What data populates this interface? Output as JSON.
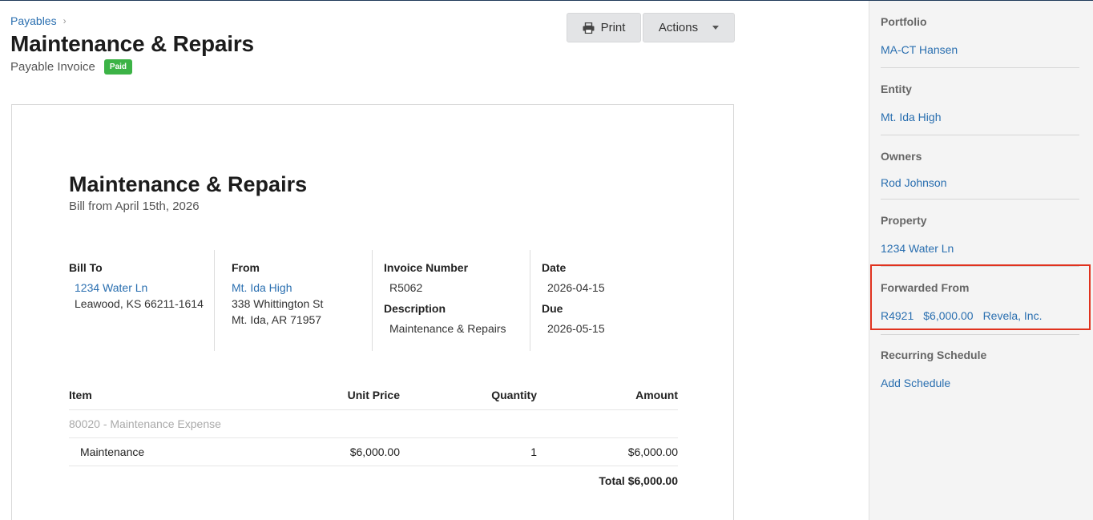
{
  "breadcrumb": {
    "parent": "Payables",
    "chevron": "›"
  },
  "header": {
    "title": "Maintenance & Repairs",
    "subtitle": "Payable Invoice",
    "status_badge": "Paid",
    "status_color": "#3cb346"
  },
  "toolbar": {
    "print_label": "Print",
    "actions_label": "Actions"
  },
  "invoice": {
    "title": "Maintenance & Repairs",
    "subtitle": "Bill from April 15th, 2026",
    "bill_to": {
      "label": "Bill To",
      "name": "1234 Water Ln",
      "address1": "Leawood, KS 66211-1614"
    },
    "from": {
      "label": "From",
      "name": "Mt. Ida High",
      "address1": "338 Whittington St",
      "address2": "Mt. Ida, AR 71957"
    },
    "invoice_number": {
      "label": "Invoice Number",
      "value": "R5062"
    },
    "description": {
      "label": "Description",
      "value": "Maintenance & Repairs"
    },
    "date": {
      "label": "Date",
      "value": "2026-04-15"
    },
    "due": {
      "label": "Due",
      "value": "2026-05-15"
    },
    "table": {
      "headers": {
        "item": "Item",
        "unit_price": "Unit Price",
        "quantity": "Quantity",
        "amount": "Amount"
      },
      "group": "80020 - Maintenance Expense",
      "rows": [
        {
          "item": "Maintenance",
          "unit_price": "$6,000.00",
          "quantity": "1",
          "amount": "$6,000.00"
        }
      ],
      "total": "Total $6,000.00"
    }
  },
  "sidebar": {
    "portfolio": {
      "label": "Portfolio",
      "value": "MA-CT Hansen"
    },
    "entity": {
      "label": "Entity",
      "value": "Mt. Ida High"
    },
    "owners": {
      "label": "Owners",
      "value": "Rod Johnson"
    },
    "property": {
      "label": "Property",
      "value": "1234 Water Ln"
    },
    "forwarded_from": {
      "label": "Forwarded From",
      "number": "R4921",
      "amount": "$6,000.00",
      "vendor": "Revela, Inc."
    },
    "recurring": {
      "label": "Recurring Schedule",
      "action": "Add Schedule"
    }
  },
  "colors": {
    "link": "#2a6fb0",
    "highlight": "#e0321e"
  }
}
